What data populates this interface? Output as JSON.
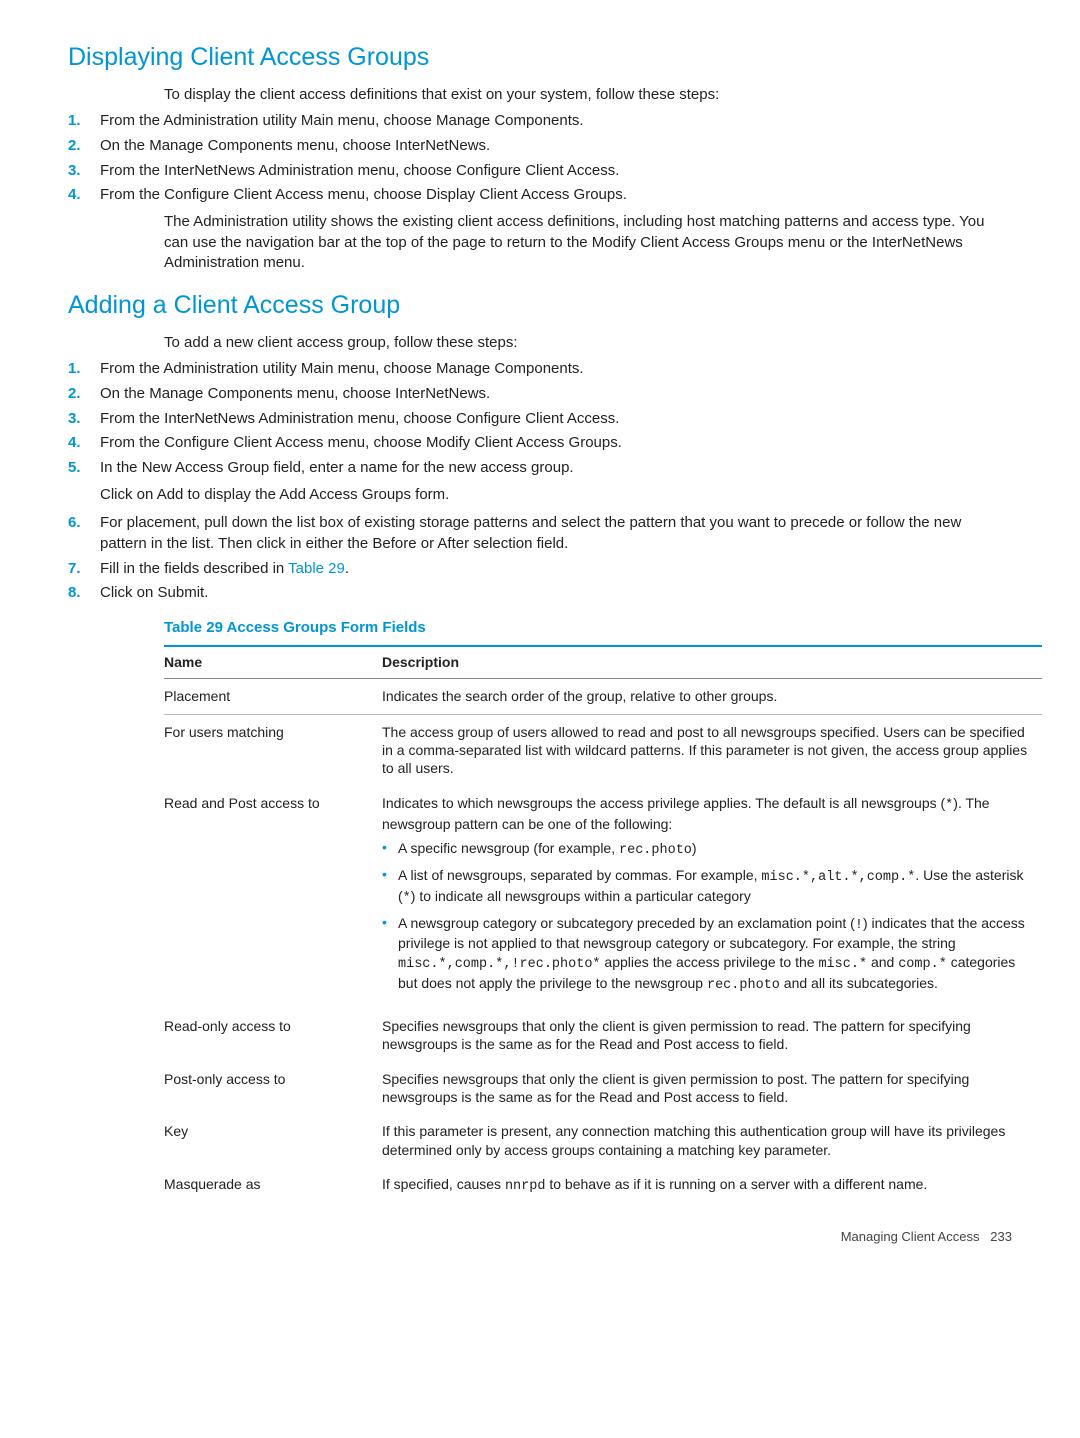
{
  "section1": {
    "title": "Displaying Client Access Groups",
    "intro": "To display the client access definitions that exist on your system, follow these steps:",
    "steps": [
      "From the Administration utility Main menu, choose Manage Components.",
      "On the Manage Components menu, choose InterNetNews.",
      "From the InterNetNews Administration menu, choose Configure Client Access.",
      "From the Configure Client Access menu, choose Display Client Access Groups."
    ],
    "para": "The Administration utility shows the existing client access definitions, including host matching patterns and access type. You can use the navigation bar at the top of the page to return to the Modify Client Access Groups menu or the InterNetNews Administration menu."
  },
  "section2": {
    "title": "Adding a Client Access Group",
    "intro": "To add a new client access group, follow these steps:",
    "steps": [
      "From the Administration utility Main menu, choose Manage Components.",
      "On the Manage Components menu, choose InterNetNews.",
      "From the InterNetNews Administration menu, choose Configure Client Access.",
      "From the Configure Client Access menu, choose Modify Client Access Groups.",
      "In the New Access Group field, enter a name for the new access group.",
      "For placement, pull down the list box of existing storage patterns and select the pattern that you want to precede or follow the new pattern in the list. Then click in either the Before or After selection field.",
      "Fill in the fields described in ",
      "Click on Submit."
    ],
    "step5b": "Click on Add to display the Add Access Groups form.",
    "table_ref": "Table 29",
    "step7_tail": "."
  },
  "table": {
    "caption": "Table 29 Access Groups Form Fields",
    "head_name": "Name",
    "head_desc": "Description",
    "rows": {
      "placement": {
        "name": "Placement",
        "desc": "Indicates the search order of the group, relative to other groups."
      },
      "users": {
        "name": "For users matching",
        "desc": "The access group of users allowed to read and post to all newsgroups specified. Users can be specified in a comma-separated list with wildcard patterns. If this parameter is not given, the access group applies to all users."
      },
      "rpa": {
        "name": "Read and Post access to",
        "desc_pre": "Indicates to which newsgroups the access privilege applies. The default is all newsgroups (",
        "star": "*",
        "desc_post": "). The newsgroup pattern can be one of the following:",
        "b1_pre": "A specific newsgroup (for example, ",
        "b1_code": "rec.photo",
        "b1_post": ")",
        "b2_pre": "A list of newsgroups, separated by commas. For example, ",
        "b2_code": "misc.*,alt.*,comp.*",
        "b2_mid": ". Use the asterisk (",
        "b2_star": "*",
        "b2_post": ") to indicate all newsgroups within a particular category",
        "b3_pre": "A newsgroup category or subcategory preceded by an exclamation point (",
        "b3_excl": "!",
        "b3_p2": ") indicates that the access privilege is not applied to that newsgroup category or subcategory. For example, the string ",
        "b3_code1": "misc.*,comp.*,!rec.photo*",
        "b3_p3": " applies the access privilege to the ",
        "b3_code2": "misc.*",
        "b3_and": " and ",
        "b3_code3": "comp.*",
        "b3_p4": " categories but does not apply the privilege to the newsgroup ",
        "b3_code4": "rec.photo",
        "b3_p5": " and all its subcategories."
      },
      "readonly": {
        "name": "Read-only access to",
        "desc": "Specifies newsgroups that only the client is given permission to read. The pattern for specifying newsgroups is the same as for the Read and Post access to field."
      },
      "postonly": {
        "name": "Post-only access to",
        "desc": "Specifies newsgroups that only the client is given permission to post. The pattern for specifying newsgroups is the same as for the Read and Post access to field."
      },
      "key": {
        "name": "Key",
        "desc": "If this parameter is present, any connection matching this authentication group will have its privileges determined only by access groups containing a matching key parameter."
      },
      "masq": {
        "name": "Masquerade as",
        "desc_pre": "If specified, causes ",
        "code": "nnrpd",
        "desc_post": " to behave as if it is running on a server with a different name."
      }
    }
  },
  "footer": {
    "label": "Managing Client Access",
    "page": "233"
  }
}
